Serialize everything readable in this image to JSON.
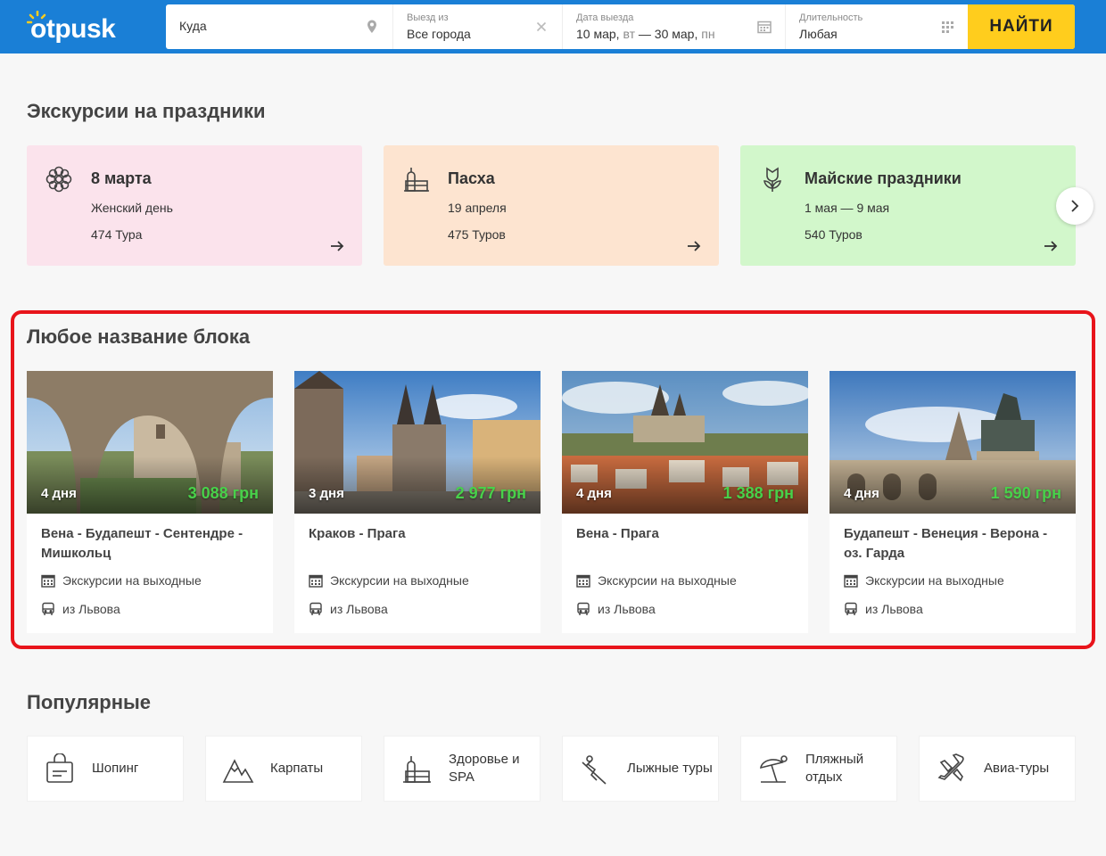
{
  "header": {
    "logo": "otpusk",
    "where_placeholder": "Куда",
    "from_label": "Выезд из",
    "from_value": "Все города",
    "date_label": "Дата выезда",
    "date_value_start": "10 мар, ",
    "date_dow_start": "вт",
    "date_sep": " — ",
    "date_value_end": "30 мар, ",
    "date_dow_end": "пн",
    "duration_label": "Длительность",
    "duration_value": "Любая",
    "find_button": "НАЙТИ",
    "brand_color": "#1a7fd6",
    "button_color": "#ffcd1d"
  },
  "holidays": {
    "title": "Экскурсии на праздники",
    "cards": [
      {
        "title": "8 марта",
        "subtitle": "Женский день",
        "count": "474 Тура",
        "icon": "flower-icon",
        "color": "#fbe3ec"
      },
      {
        "title": "Пасха",
        "subtitle": "19 апреля",
        "count": "475 Туров",
        "icon": "easter-cake-icon",
        "color": "#fde4d0"
      },
      {
        "title": "Майские праздники",
        "subtitle": "1 мая — 9 мая",
        "count": "540 Туров",
        "icon": "tulip-icon",
        "color": "#d2f7cb"
      }
    ]
  },
  "block": {
    "title": "Любое название блока",
    "tours": [
      {
        "days": "4 дня",
        "price": "3 088 грн",
        "title": "Вена - Будапешт - Сентендре - Мишкольц",
        "type": "Экскурсии на выходные",
        "from": "из Львова"
      },
      {
        "days": "3 дня",
        "price": "2 977 грн",
        "title": "Краков - Прага",
        "type": "Экскурсии на выходные",
        "from": "из Львова"
      },
      {
        "days": "4 дня",
        "price": "1 388 грн",
        "title": "Вена - Прага",
        "type": "Экскурсии на выходные",
        "from": "из Львова"
      },
      {
        "days": "4 дня",
        "price": "1 590 грн",
        "title": "Будапешт - Венеция - Верона - оз. Гарда",
        "type": "Экскурсии на выходные",
        "from": "из Львова"
      }
    ]
  },
  "popular": {
    "title": "Популярные",
    "items": [
      {
        "label": "Шопинг",
        "icon": "shopping-bag-icon"
      },
      {
        "label": "Карпаты",
        "icon": "mountain-icon"
      },
      {
        "label": "Здоровье и SPA",
        "icon": "spa-icon"
      },
      {
        "label": "Лыжные туры",
        "icon": "ski-icon"
      },
      {
        "label": "Пляжный отдых",
        "icon": "beach-umbrella-icon"
      },
      {
        "label": "Авиа-туры",
        "icon": "airplane-icon"
      }
    ]
  }
}
